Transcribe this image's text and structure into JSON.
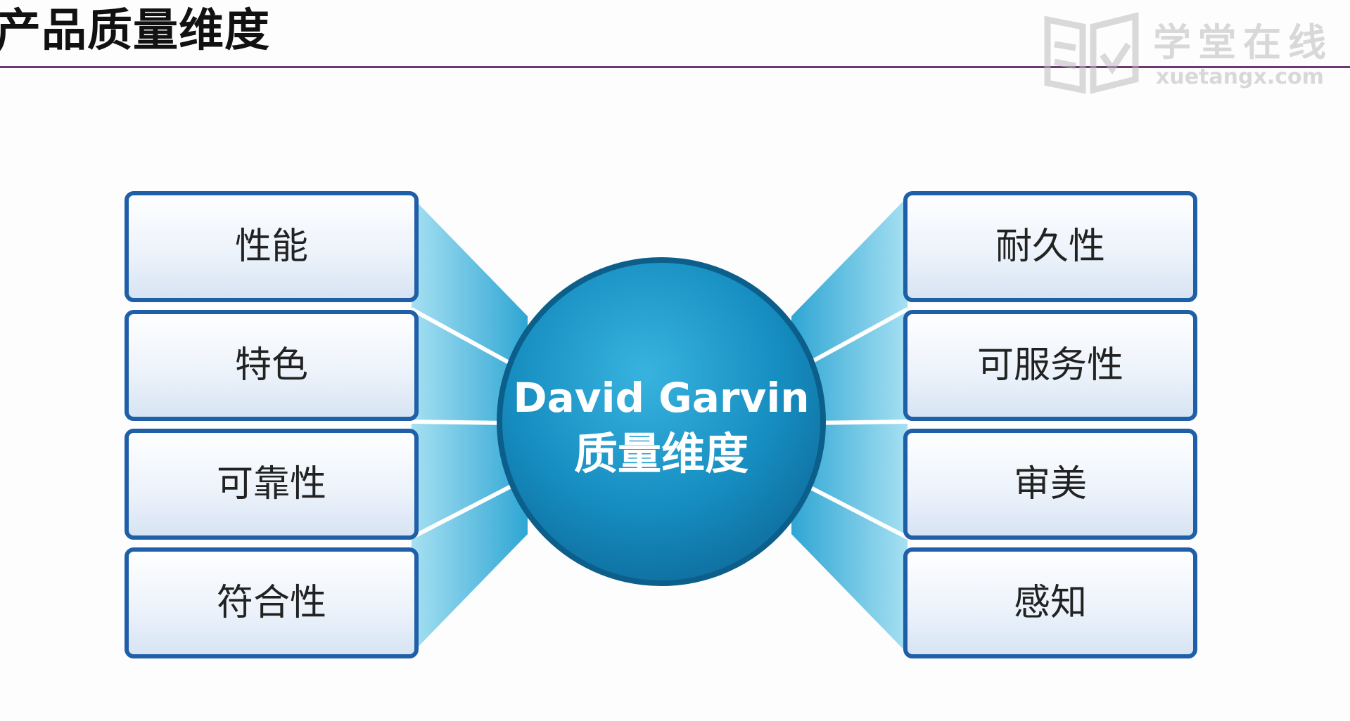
{
  "header": {
    "title": "产品质量维度"
  },
  "watermark": {
    "logo_text": "学堂在线",
    "logo_url_text": "xuetangx.com"
  },
  "center": {
    "line1": "David Garvin",
    "line2": "质量维度"
  },
  "left_dimensions": [
    "性能",
    "特色",
    "可靠性",
    "符合性"
  ],
  "right_dimensions": [
    "耐久性",
    "可服务性",
    "审美",
    "感知"
  ],
  "colors": {
    "accent": "#1a8ab8",
    "fan": "#63c2e2",
    "box_border": "#1f5fa8",
    "rule": "#6b3a6e"
  }
}
